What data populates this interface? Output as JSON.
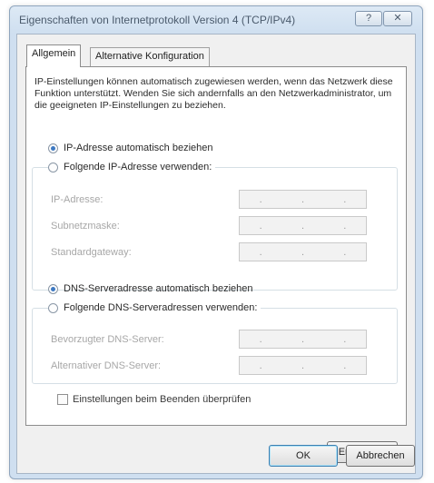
{
  "window": {
    "title": "Eigenschaften von Internetprotokoll Version 4 (TCP/IPv4)",
    "help_label": "?",
    "close_label": "✕"
  },
  "tabs": [
    {
      "label": "Allgemein",
      "active": true
    },
    {
      "label": "Alternative Konfiguration",
      "active": false
    }
  ],
  "description": "IP-Einstellungen können automatisch zugewiesen werden, wenn das Netzwerk diese Funktion unterstützt. Wenden Sie sich andernfalls an den Netzwerkadministrator, um die geeigneten IP-Einstellungen zu beziehen.",
  "ip": {
    "auto_label": "IP-Adresse automatisch beziehen",
    "auto_selected": true,
    "manual_label": "Folgende IP-Adresse verwenden:",
    "fields": [
      {
        "label": "IP-Adresse:"
      },
      {
        "label": "Subnetzmaske:"
      },
      {
        "label": "Standardgateway:"
      }
    ]
  },
  "dns": {
    "auto_label": "DNS-Serveradresse automatisch beziehen",
    "auto_selected": true,
    "manual_label": "Folgende DNS-Serveradressen verwenden:",
    "fields": [
      {
        "label": "Bevorzugter DNS-Server:"
      },
      {
        "label": "Alternativer DNS-Server:"
      }
    ]
  },
  "ip_separator": ".",
  "validate_checkbox": {
    "label": "Einstellungen beim Beenden überprüfen",
    "checked": false
  },
  "buttons": {
    "advanced": "Erweitert...",
    "ok": "OK",
    "cancel": "Abbrechen"
  },
  "colors": {
    "titlebar": "#cfdff0",
    "radio_selected": "#3d79c2",
    "disabled_text": "#a7a7a7"
  }
}
